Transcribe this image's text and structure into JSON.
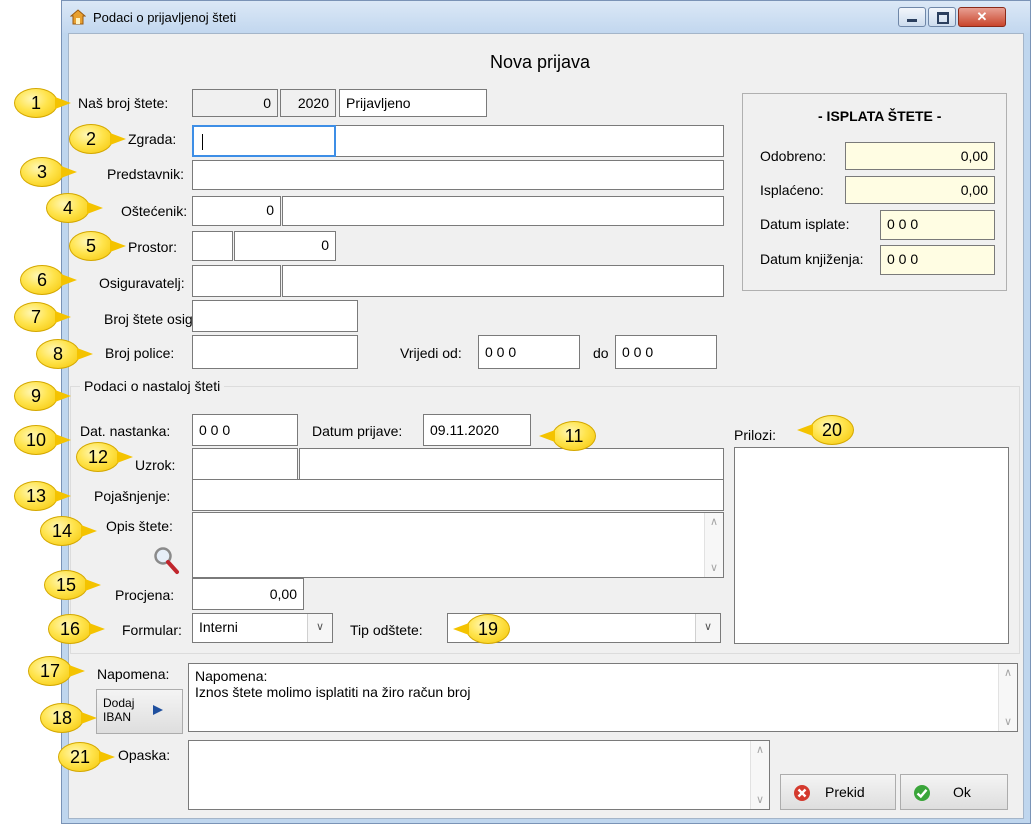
{
  "window": {
    "title": "Podaci o prijavljenoj šteti"
  },
  "form_title": "Nova prijava",
  "fields": {
    "nas_broj_label": "Naš broj štete:",
    "nas_broj_value": "0",
    "nas_broj_year": "2020",
    "nas_broj_status": "Prijavljeno",
    "zgrada_label": "Zgrada:",
    "predstavnik_label": "Predstavnik:",
    "ostecenik_label": "Oštećenik:",
    "ostecenik_value": "0",
    "prostor_label": "Prostor:",
    "prostor_value": "0",
    "osiguravatelj_label": "Osiguravatelj:",
    "broj_stete_osig_label": "Broj štete osig:",
    "broj_police_label": "Broj police:",
    "vrijedi_od_label": "Vrijedi od:",
    "vrijedi_od_value": "0 0 0",
    "do_label": "do",
    "do_value": "0 0 0"
  },
  "isplata": {
    "title": "- ISPLATA ŠTETE -",
    "odobreno_label": "Odobreno:",
    "odobreno_value": "0,00",
    "isplaceno_label": "Isplaćeno:",
    "isplaceno_value": "0,00",
    "datum_isplate_label": "Datum isplate:",
    "datum_isplate_value": "0 0 0",
    "datum_knjizenja_label": "Datum knjiženja:",
    "datum_knjizenja_value": "0 0 0"
  },
  "steta": {
    "group_title": "Podaci o nastaloj šteti",
    "dat_nastanka_label": "Dat. nastanka:",
    "dat_nastanka_value": "0 0 0",
    "datum_prijave_label": "Datum prijave:",
    "datum_prijave_value": "09.11.2020",
    "uzrok_label": "Uzrok:",
    "pojasnjenje_label": "Pojašnjenje:",
    "opis_label": "Opis štete:",
    "procjena_label": "Procjena:",
    "procjena_value": "0,00",
    "formular_label": "Formular:",
    "formular_value": "Interni",
    "tip_odstete_label": "Tip odštete:",
    "prilozi_label": "Prilozi:"
  },
  "napomena": {
    "label": "Napomena:",
    "line1": "Napomena:",
    "line2": "Iznos štete molimo isplatiti na žiro račun broj",
    "dodaj_iban_line1": "Dodaj",
    "dodaj_iban_line2": "IBAN"
  },
  "opaska": {
    "label": "Opaska:"
  },
  "buttons": {
    "prekid": "Prekid",
    "ok": "Ok"
  },
  "callouts": [
    "1",
    "2",
    "3",
    "4",
    "5",
    "6",
    "7",
    "8",
    "9",
    "10",
    "11",
    "12",
    "13",
    "14",
    "15",
    "16",
    "17",
    "18",
    "19",
    "20",
    "21"
  ],
  "colors": {
    "readonly_bg": "#f0f0f0",
    "highlight_bg": "#fffde3",
    "callout": "#ffe44d",
    "titlebar": "#c2d7ef"
  }
}
